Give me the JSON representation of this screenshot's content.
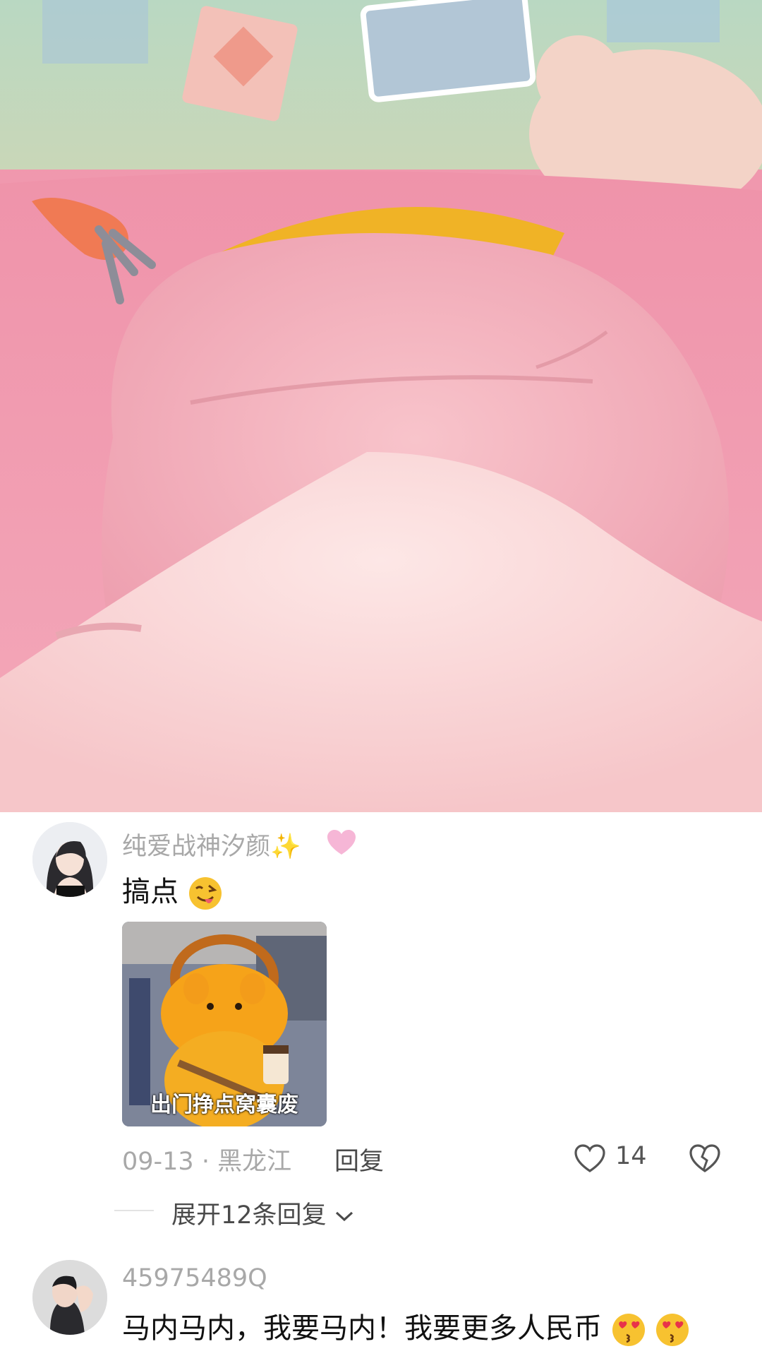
{
  "media": {
    "description_icon": "carrot-pin-icon"
  },
  "comments": [
    {
      "username": "纯爱战神汐颜",
      "text": "搞点",
      "sticker_caption": "出门挣点窝囊废",
      "date": "09-13",
      "separator": "·",
      "location": "黑龙江",
      "reply_label": "回复",
      "likes": "14",
      "expand_label": "展开12条回复"
    },
    {
      "username": "45975489Q",
      "text": "马内马内，我要马内！我要更多人民币"
    }
  ],
  "colors": {
    "meta_gray": "#a8a8a8",
    "text_dark": "#111111",
    "heart_pink": "#f6b6d6"
  }
}
